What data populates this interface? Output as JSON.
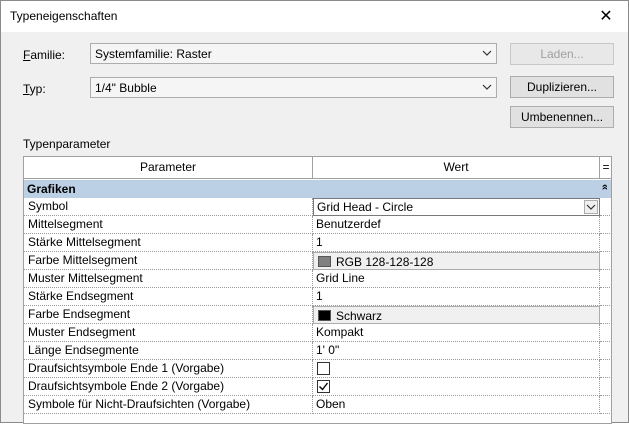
{
  "window": {
    "title": "Typeneigenschaften",
    "close_glyph": "✕"
  },
  "family": {
    "label_accel": "F",
    "label_rest": "amilie:",
    "value": "Systemfamilie: Raster"
  },
  "type": {
    "label_accel": "T",
    "label_rest": "yp:",
    "value": "1/4\" Bubble"
  },
  "buttons": {
    "load": "Laden...",
    "duplicate": "Duplizieren...",
    "rename": "Umbenennen..."
  },
  "type_parameters_label": "Typenparameter",
  "grid": {
    "col_parameter": "Parameter",
    "col_value": "Wert",
    "col_extra": "=",
    "group": "Grafiken",
    "group_collapse_glyph": "»",
    "rows": [
      {
        "param": "Symbol",
        "value": "Grid Head - Circle",
        "kind": "combo"
      },
      {
        "param": "Mittelsegment",
        "value": "Benutzerdef",
        "kind": "text"
      },
      {
        "param": "Stärke Mittelsegment",
        "value": "1",
        "kind": "text"
      },
      {
        "param": "Farbe Mittelsegment",
        "value": "RGB 128-128-128",
        "kind": "color",
        "swatch": "#808080"
      },
      {
        "param": "Muster Mittelsegment",
        "value": "Grid Line",
        "kind": "text"
      },
      {
        "param": "Stärke Endsegment",
        "value": "1",
        "kind": "text"
      },
      {
        "param": "Farbe Endsegment",
        "value": "Schwarz",
        "kind": "color",
        "swatch": "#000000"
      },
      {
        "param": "Muster Endsegment",
        "value": "Kompakt",
        "kind": "text"
      },
      {
        "param": "Länge Endsegmente",
        "value": "1'  0\"",
        "kind": "text"
      },
      {
        "param": "Draufsichtsymbole Ende 1 (Vorgabe)",
        "value": "",
        "kind": "checkbox",
        "checked": false
      },
      {
        "param": "Draufsichtsymbole Ende 2 (Vorgabe)",
        "value": "",
        "kind": "checkbox",
        "checked": true
      },
      {
        "param": "Symbole für Nicht-Draufsichten (Vorgabe)",
        "value": "Oben",
        "kind": "text"
      }
    ]
  }
}
